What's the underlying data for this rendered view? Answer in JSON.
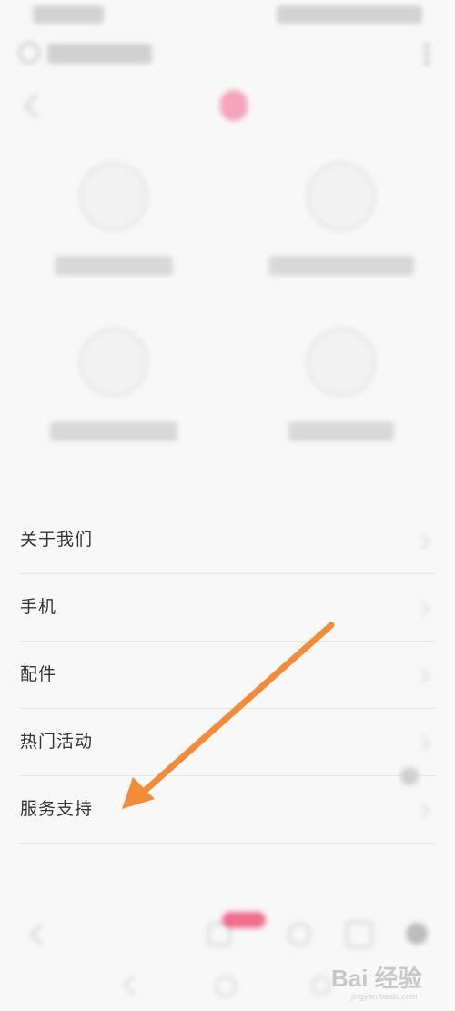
{
  "menu": {
    "items": [
      {
        "label": "关于我们"
      },
      {
        "label": "手机"
      },
      {
        "label": "配件"
      },
      {
        "label": "热门活动"
      },
      {
        "label": "服务支持"
      }
    ]
  },
  "annotation": {
    "color": "#f28c38",
    "target_item": "服务支持"
  },
  "watermark": {
    "text": "Bai 经验",
    "sub": "jingyan.baidu.com",
    "brand_color": "#c8c8c8"
  },
  "colors": {
    "accent_pink": "#ef6f8d",
    "menu_text": "#333333",
    "divider": "#e5e5e5"
  }
}
